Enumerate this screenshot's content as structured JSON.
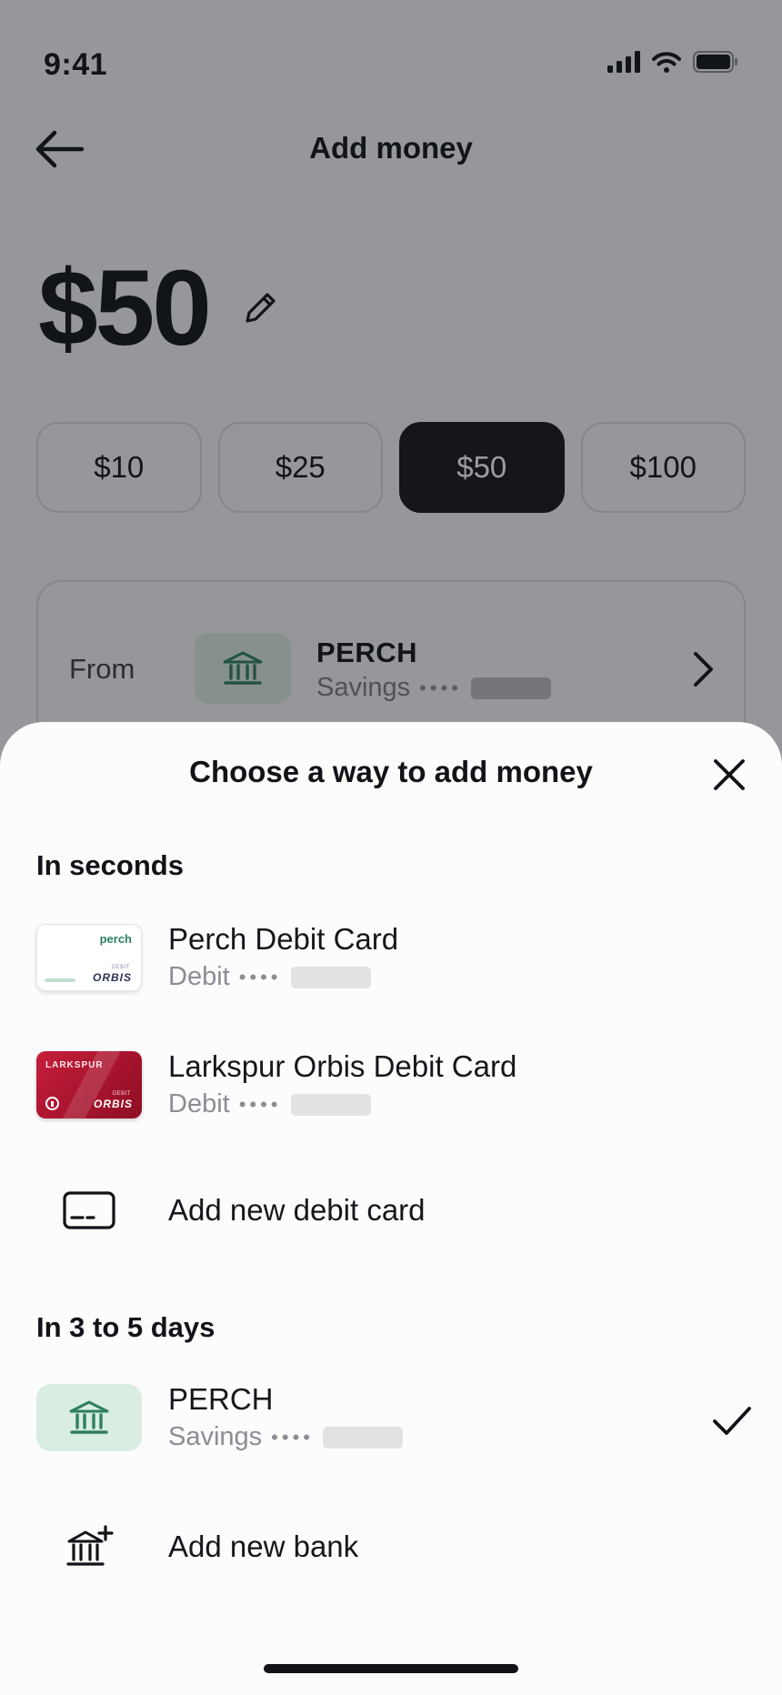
{
  "status_bar": {
    "time": "9:41"
  },
  "header": {
    "title": "Add money"
  },
  "amount": {
    "value": "$50"
  },
  "presets": [
    {
      "label": "$10",
      "selected": false
    },
    {
      "label": "$25",
      "selected": false
    },
    {
      "label": "$50",
      "selected": true
    },
    {
      "label": "$100",
      "selected": false
    }
  ],
  "from": {
    "label": "From",
    "bank_name": "PERCH",
    "account_type": "Savings",
    "masked_dots": "••••"
  },
  "sheet": {
    "title": "Choose a way to add money",
    "instant_section": {
      "title": "In seconds",
      "items": [
        {
          "name": "Perch Debit Card",
          "type": "Debit",
          "masked_dots": "••••",
          "card_art": {
            "brand": "perch",
            "debit_text": "DEBIT",
            "network": "ORBIS"
          }
        },
        {
          "name": "Larkspur Orbis Debit Card",
          "type": "Debit",
          "masked_dots": "••••",
          "card_art": {
            "brand": "LARKSPUR",
            "debit_text": "DEBIT",
            "network": "ORBIS"
          }
        }
      ],
      "add_card_label": "Add new debit card"
    },
    "standard_section": {
      "title": "In 3 to 5 days",
      "bank": {
        "name": "PERCH",
        "type": "Savings",
        "masked_dots": "••••",
        "selected": true
      },
      "add_bank_label": "Add new bank"
    }
  },
  "colors": {
    "accent_green": "#2f7f5c",
    "bank_tile_bg": "#d9ede3",
    "selected_preset_bg": "#16181d",
    "card_red": "#b0162f"
  }
}
